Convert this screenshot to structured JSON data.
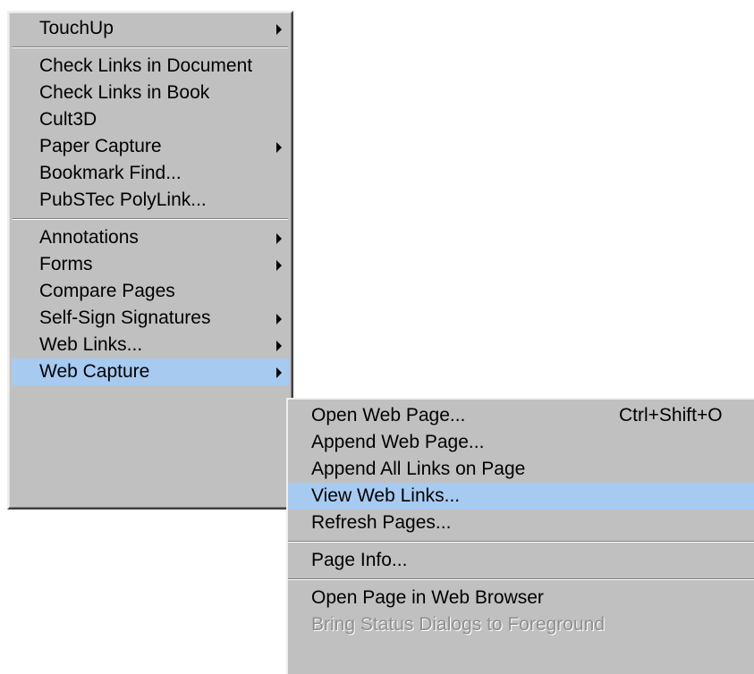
{
  "main_menu": {
    "items": [
      {
        "label": "TouchUp",
        "submenu": true
      },
      {
        "label": "Check Links in Document"
      },
      {
        "label": "Check Links in Book"
      },
      {
        "label": "Cult3D"
      },
      {
        "label": "Paper Capture",
        "submenu": true
      },
      {
        "label": "Bookmark Find..."
      },
      {
        "label": "PubSTec PolyLink..."
      },
      {
        "label": "Annotations",
        "submenu": true
      },
      {
        "label": "Forms",
        "submenu": true
      },
      {
        "label": "Compare Pages"
      },
      {
        "label": "Self-Sign Signatures",
        "submenu": true
      },
      {
        "label": "Web Links...",
        "submenu": true
      },
      {
        "label": "Web Capture",
        "submenu": true,
        "highlighted": true
      }
    ]
  },
  "web_capture_submenu": {
    "items": [
      {
        "label": "Open Web Page...",
        "shortcut": "Ctrl+Shift+O"
      },
      {
        "label": "Append Web Page..."
      },
      {
        "label": "Append All Links on Page"
      },
      {
        "label": "View Web Links...",
        "highlighted": true
      },
      {
        "label": "Refresh Pages..."
      },
      {
        "label": "Page Info..."
      },
      {
        "label": "Open Page in Web Browser"
      },
      {
        "label": "Bring Status Dialogs to Foreground",
        "disabled": true
      }
    ]
  },
  "colors": {
    "menu_background": "#c0c0c0",
    "highlight": "#a6caf0",
    "disabled_text": "#8f8f8f"
  },
  "icons": {
    "submenu_arrow": "submenu-arrow-icon"
  }
}
